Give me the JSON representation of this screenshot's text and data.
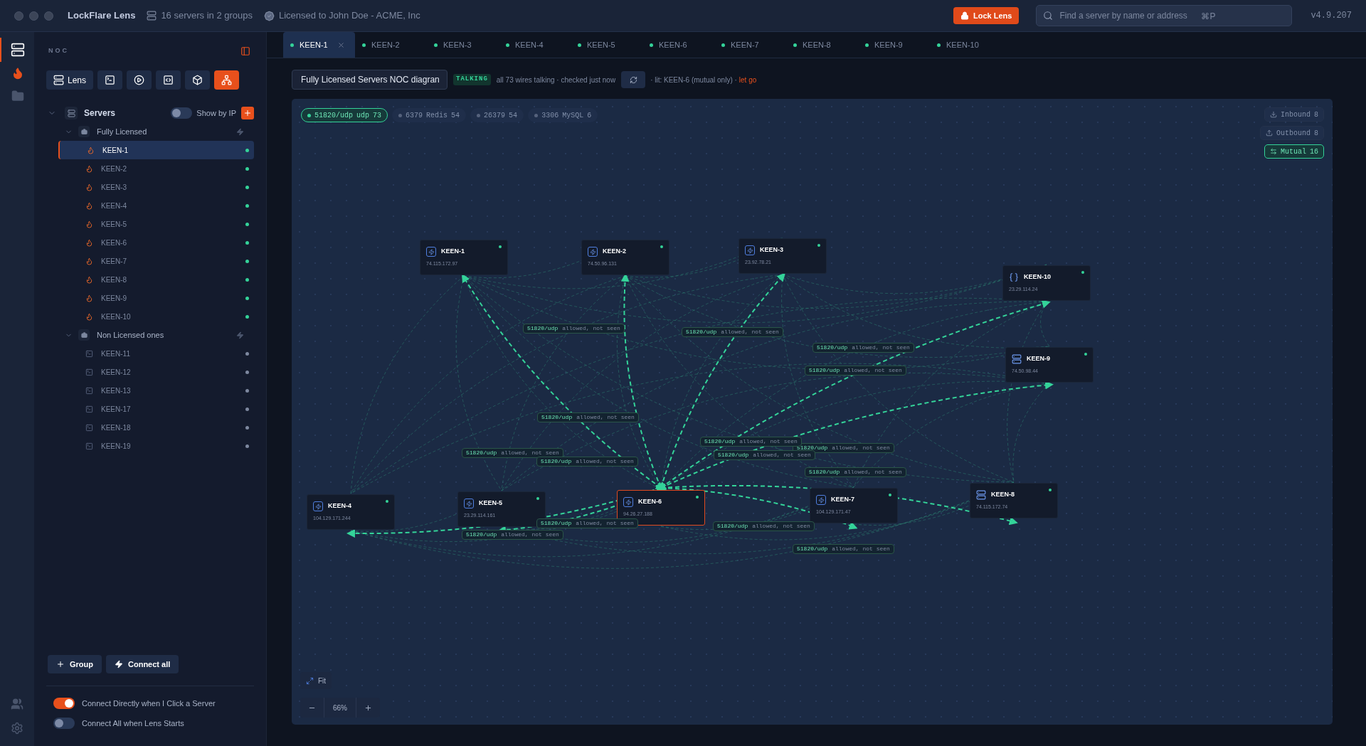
{
  "app": {
    "title": "LockFlare Lens",
    "summary": "16 servers in 2 groups",
    "license": "Licensed to John Doe - ACME, Inc",
    "lock_button": "Lock Lens",
    "search": {
      "placeholder": "Find a server by name or address",
      "shortcut": "⌘P"
    },
    "version": "v4.9.207"
  },
  "rail": [
    {
      "kind": "servers",
      "selected": true
    },
    {
      "kind": "flame",
      "selected": false
    },
    {
      "kind": "folder",
      "selected": false
    }
  ],
  "rail_bottom": [
    {
      "kind": "users"
    },
    {
      "kind": "settings"
    }
  ],
  "sidebar": {
    "title": "NOC",
    "tools": [
      {
        "kind": "lens",
        "label": "Lens",
        "selected": false
      },
      {
        "kind": "terminal",
        "selected": false
      },
      {
        "kind": "play",
        "selected": false
      },
      {
        "kind": "code",
        "selected": false
      },
      {
        "kind": "box",
        "selected": false
      },
      {
        "kind": "network",
        "selected": true
      }
    ],
    "root": {
      "label": "Servers",
      "expanded": true,
      "show_by_ip": {
        "label": "Show by IP",
        "on": false
      }
    },
    "groups": [
      {
        "label": "Fully Licensed",
        "expanded": true,
        "children": [
          {
            "name": "KEEN-1",
            "kind": "licensed",
            "selected": true,
            "online": true
          },
          {
            "name": "KEEN-2",
            "kind": "licensed",
            "selected": false,
            "online": true
          },
          {
            "name": "KEEN-3",
            "kind": "licensed",
            "selected": false,
            "online": true
          },
          {
            "name": "KEEN-4",
            "kind": "licensed",
            "selected": false,
            "online": true
          },
          {
            "name": "KEEN-5",
            "kind": "licensed",
            "selected": false,
            "online": true
          },
          {
            "name": "KEEN-6",
            "kind": "licensed",
            "selected": false,
            "online": true
          },
          {
            "name": "KEEN-7",
            "kind": "licensed",
            "selected": false,
            "online": true
          },
          {
            "name": "KEEN-8",
            "kind": "licensed",
            "selected": false,
            "online": true
          },
          {
            "name": "KEEN-9",
            "kind": "licensed",
            "selected": false,
            "online": true
          },
          {
            "name": "KEEN-10",
            "kind": "licensed",
            "selected": false,
            "online": true
          }
        ]
      },
      {
        "label": "Non Licensed ones",
        "expanded": true,
        "children": [
          {
            "name": "KEEN-11",
            "kind": "unlicensed",
            "selected": false,
            "online": false
          },
          {
            "name": "KEEN-12",
            "kind": "unlicensed",
            "selected": false,
            "online": false
          },
          {
            "name": "KEEN-13",
            "kind": "unlicensed",
            "selected": false,
            "online": false
          },
          {
            "name": "KEEN-17",
            "kind": "unlicensed",
            "selected": false,
            "online": false
          },
          {
            "name": "KEEN-18",
            "kind": "unlicensed",
            "selected": false,
            "online": false
          },
          {
            "name": "KEEN-19",
            "kind": "unlicensed",
            "selected": false,
            "online": false
          }
        ]
      }
    ],
    "footer_buttons": [
      {
        "kind": "add",
        "label": "Group"
      },
      {
        "kind": "connect",
        "label": "Connect all"
      }
    ],
    "settings": [
      {
        "label": "Connect Directly when I Click a Server",
        "on": true
      },
      {
        "label": "Connect All when Lens Starts",
        "on": false
      }
    ]
  },
  "tabs": [
    {
      "label": "KEEN-1",
      "selected": true,
      "online": true
    },
    {
      "label": "KEEN-2",
      "selected": false,
      "online": true
    },
    {
      "label": "KEEN-3",
      "selected": false,
      "online": true
    },
    {
      "label": "KEEN-4",
      "selected": false,
      "online": true
    },
    {
      "label": "KEEN-5",
      "selected": false,
      "online": true
    },
    {
      "label": "KEEN-6",
      "selected": false,
      "online": true
    },
    {
      "label": "KEEN-7",
      "selected": false,
      "online": true
    },
    {
      "label": "KEEN-8",
      "selected": false,
      "online": true
    },
    {
      "label": "KEEN-9",
      "selected": false,
      "online": true
    },
    {
      "label": "KEEN-10",
      "selected": false,
      "online": true
    }
  ],
  "diagram": {
    "name": "Fully Licensed Servers NOC diagran",
    "status": "TALKING",
    "status_text": "all 73 wires talking · checked just now",
    "lit_text": "· lit: KEEN-6 (mutual only) ·",
    "release_link": "let go",
    "ports": [
      {
        "port": "51820/udp",
        "proto": "udp",
        "count": "73",
        "selected": true
      },
      {
        "port": "6379",
        "proto": "Redis",
        "count": "54",
        "selected": false
      },
      {
        "port": "26379",
        "count": "54",
        "selected": false
      },
      {
        "port": "3306",
        "proto": "MySQL",
        "count": "6",
        "selected": false
      }
    ],
    "directions": [
      {
        "kind": "inbound",
        "label": "Inbound",
        "count": "8",
        "selected": false
      },
      {
        "kind": "outbound",
        "label": "Outbound",
        "count": "8",
        "selected": false
      },
      {
        "kind": "mutual",
        "label": "Mutual",
        "count": "16",
        "selected": true
      }
    ],
    "nodes": [
      {
        "name": "KEEN-1",
        "address": "74.115.172.97",
        "kind": "bolt",
        "selected": false,
        "online": true
      },
      {
        "name": "KEEN-2",
        "address": "74.50.96.131",
        "kind": "bolt",
        "selected": false,
        "online": true
      },
      {
        "name": "KEEN-3",
        "address": "23.92.78.21",
        "kind": "bolt",
        "selected": false,
        "online": true
      },
      {
        "name": "KEEN-10",
        "address": "23.29.114.24",
        "kind": "braces",
        "selected": false,
        "online": true
      },
      {
        "name": "KEEN-9",
        "address": "74.50.98.44",
        "kind": "server",
        "selected": false,
        "online": true
      },
      {
        "name": "KEEN-4",
        "address": "104.129.171.244",
        "kind": "bolt",
        "selected": false,
        "online": true
      },
      {
        "name": "KEEN-5",
        "address": "23.29.114.161",
        "kind": "bolt",
        "selected": false,
        "online": true
      },
      {
        "name": "KEEN-6",
        "address": "94.26.27.188",
        "kind": "bolt",
        "selected": true,
        "online": true
      },
      {
        "name": "KEEN-7",
        "address": "104.129.171.47",
        "kind": "bolt",
        "selected": false,
        "online": true
      },
      {
        "name": "KEEN-8",
        "address": "74.115.172.74",
        "kind": "server",
        "selected": false,
        "online": true
      }
    ],
    "wire_labels": [
      {
        "port": "51820/udp",
        "note": "allowed, not seen"
      },
      {
        "port": "51820/udp",
        "note": "allowed, not seen"
      },
      {
        "port": "51820/udp",
        "note": "allowed, not seen"
      },
      {
        "port": "51820/udp",
        "note": "allowed, not seen"
      },
      {
        "port": "51820/udp",
        "note": "allowed, not seen"
      },
      {
        "port": "51820/udp",
        "note": "allowed, not seen"
      },
      {
        "port": "51820/udp",
        "note": "allowed, not seen"
      },
      {
        "port": "51820/udp",
        "note": "allowed, not seen"
      },
      {
        "port": "51820/udp",
        "note": "allowed, not seen"
      },
      {
        "port": "51820/udp",
        "note": "allowed, not seen"
      },
      {
        "port": "51820/udp",
        "note": "allowed, not seen"
      },
      {
        "port": "51820/udp",
        "note": "allowed, not seen"
      },
      {
        "port": "51820/udp",
        "note": "allowed, not seen"
      },
      {
        "port": "51820/udp",
        "note": "allowed, not seen"
      },
      {
        "port": "51820/udp",
        "note": "allowed, not seen"
      }
    ],
    "fit": "Fit",
    "zoom": "66%"
  }
}
